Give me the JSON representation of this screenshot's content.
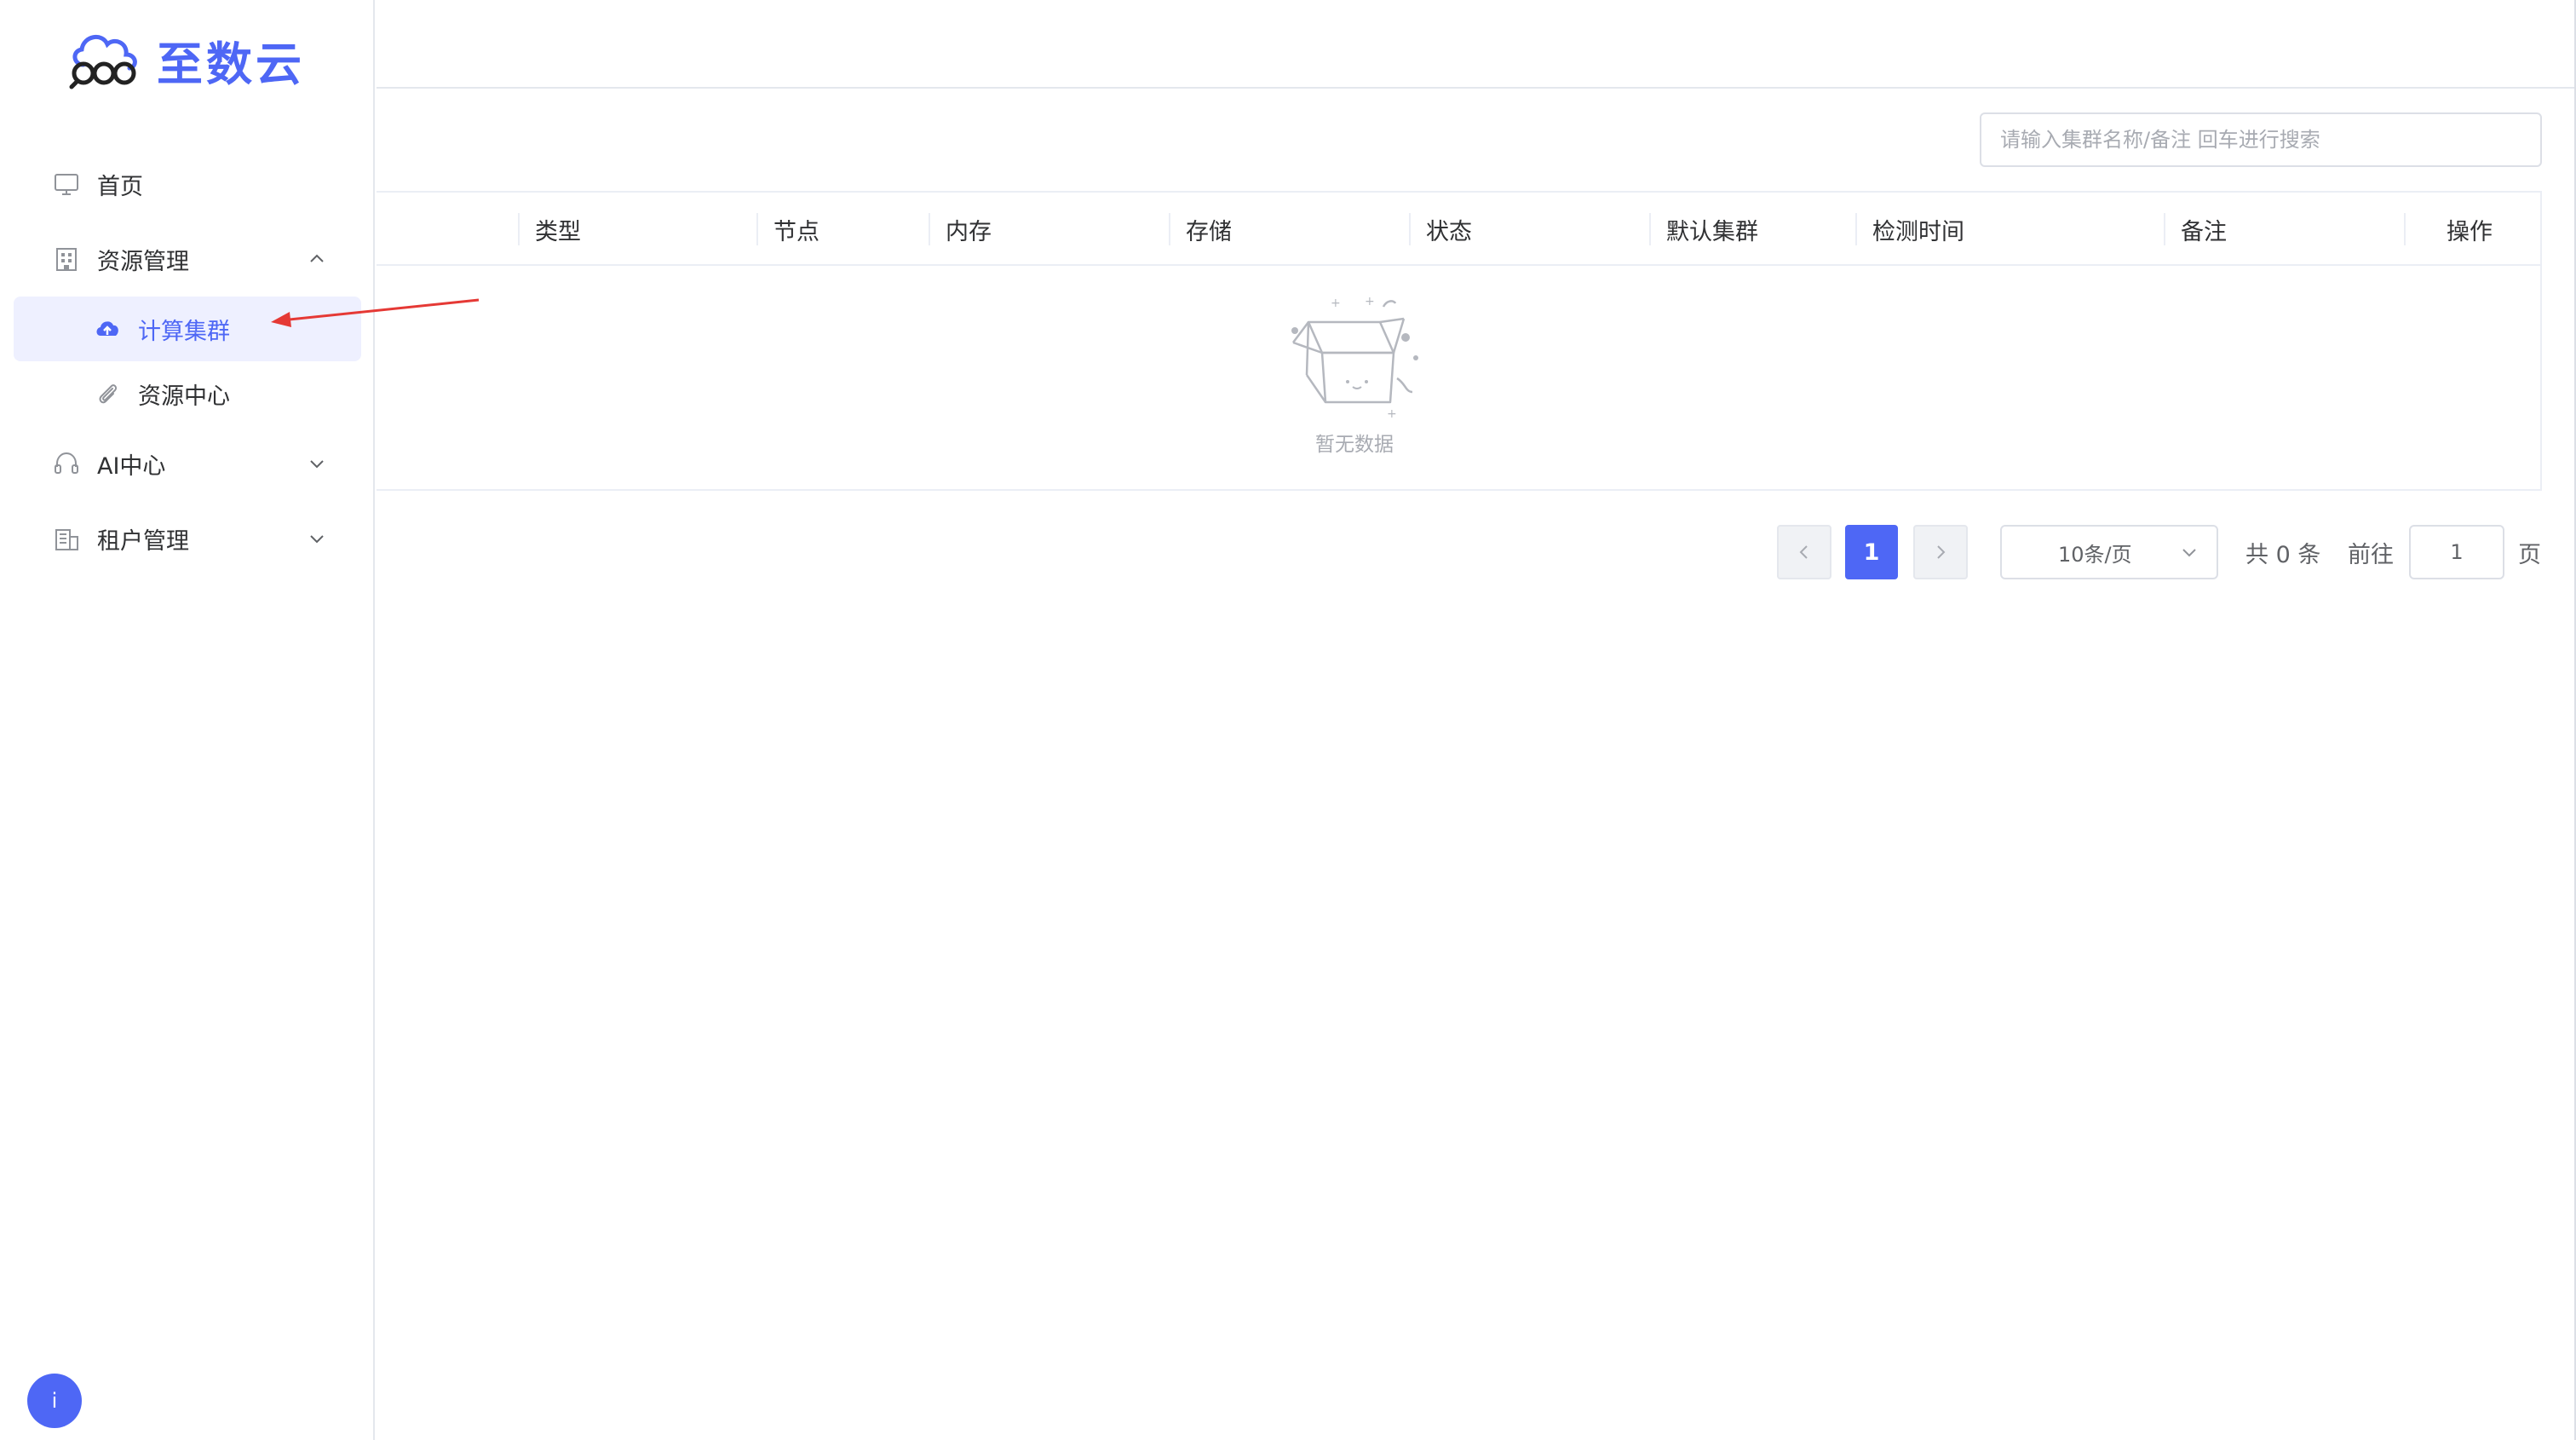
{
  "app": {
    "logo_text": "至数云",
    "accent_color": "#4e67f5"
  },
  "sidebar": {
    "items": [
      {
        "label": "首页",
        "icon": "monitor-icon"
      },
      {
        "label": "资源管理",
        "icon": "building-icon",
        "expanded": true
      },
      {
        "label": "计算集群",
        "icon": "cloud-upload-icon",
        "active": true
      },
      {
        "label": "资源中心",
        "icon": "paperclip-icon"
      },
      {
        "label": "AI中心",
        "icon": "headset-icon",
        "expanded": false
      },
      {
        "label": "租户管理",
        "icon": "office-icon",
        "expanded": false
      }
    ]
  },
  "search": {
    "placeholder": "请输入集群名称/备注 回车进行搜索",
    "value": ""
  },
  "table": {
    "columns": [
      "类型",
      "节点",
      "内存",
      "存储",
      "状态",
      "默认集群",
      "检测时间",
      "备注",
      "操作"
    ],
    "rows": [],
    "empty_text": "暂无数据"
  },
  "pagination": {
    "current_page": "1",
    "page_size": "10条/页",
    "total": "共 0 条",
    "goto_label": "前往",
    "goto_value": "1",
    "page_label": "页"
  },
  "fab": {
    "label": "i"
  }
}
